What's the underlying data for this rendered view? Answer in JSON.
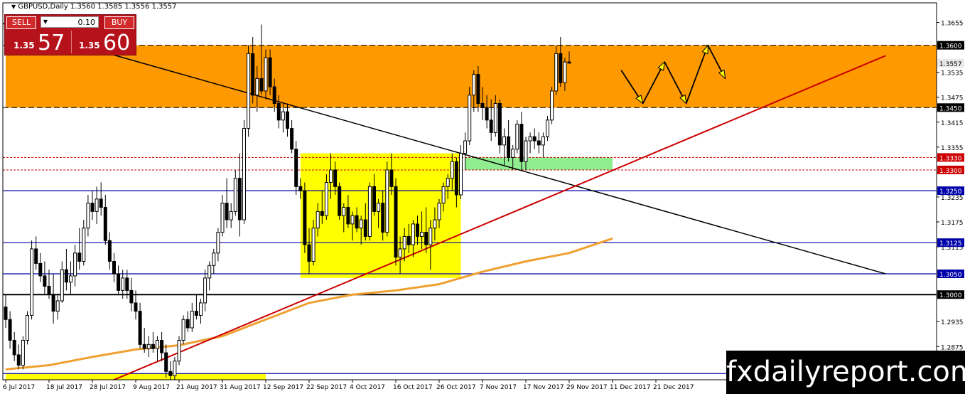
{
  "header": {
    "text": "GBPUSD,Daily  1.3560 1.3585 1.3556 1.3557",
    "icon": "triangle-down-icon"
  },
  "trade_panel": {
    "sell_label": "SELL",
    "buy_label": "BUY",
    "lot_value": "0.10",
    "sell_small": "1.35",
    "sell_big": "57",
    "buy_small": "1.35",
    "buy_big": "60"
  },
  "brand": {
    "text": "fxdailyreport.com"
  },
  "colors": {
    "resistance_zone": "#ff9900",
    "consolidation_zone": "#ffff00",
    "support_zone": "#90ee90",
    "moving_average": "#f0a030",
    "trendline_up": "#cc0000",
    "trendline_down": "#000000",
    "level_blue": "#0000aa"
  },
  "chart_data": {
    "type": "candlestick",
    "symbol": "GBPUSD",
    "timeframe": "Daily",
    "ylim": [
      1.2795,
      1.3685
    ],
    "y_ticks": [
      {
        "v": 1.3655,
        "label": "1.3655"
      },
      {
        "v": 1.3535,
        "label": "1.3535"
      },
      {
        "v": 1.3475,
        "label": "1.3475"
      },
      {
        "v": 1.3415,
        "label": "1.3415"
      },
      {
        "v": 1.3355,
        "label": "1.3355"
      },
      {
        "v": 1.3235,
        "label": "1.3235"
      },
      {
        "v": 1.3175,
        "label": "1.3175"
      },
      {
        "v": 1.3115,
        "label": "1.3115"
      },
      {
        "v": 1.2935,
        "label": "1.2935"
      },
      {
        "v": 1.2875,
        "label": "1.2875"
      }
    ],
    "price_labels": [
      {
        "v": 1.36,
        "label": "1.3600",
        "style": "dark"
      },
      {
        "v": 1.3557,
        "label": "1.3557",
        "style": "light"
      },
      {
        "v": 1.345,
        "label": "1.3450",
        "style": "dark"
      },
      {
        "v": 1.333,
        "label": "1.3330",
        "style": "red"
      },
      {
        "v": 1.33,
        "label": "1.3300",
        "style": "red"
      },
      {
        "v": 1.325,
        "label": "1.3250",
        "style": "blue"
      },
      {
        "v": 1.3125,
        "label": "1.3125",
        "style": "blue"
      },
      {
        "v": 1.305,
        "label": "1.3050",
        "style": "blue"
      },
      {
        "v": 1.3,
        "label": "1.3000",
        "style": "dark"
      }
    ],
    "x_labels": [
      "6 Jul 2017",
      "18 Jul 2017",
      "28 Jul 2017",
      "9 Aug 2017",
      "21 Aug 2017",
      "31 Aug 2017",
      "12 Sep 2017",
      "22 Sep 2017",
      "4 Oct 2017",
      "16 Oct 2017",
      "26 Oct 2017",
      "7 Nov 2017",
      "17 Nov 2017",
      "29 Nov 2017",
      "11 Dec 2017",
      "21 Dec 2017"
    ],
    "levels": [
      {
        "v": 1.36,
        "style": "dashed",
        "color": "#000000"
      },
      {
        "v": 1.345,
        "style": "dashed",
        "color": "#000000"
      },
      {
        "v": 1.333,
        "style": "dotted",
        "color": "#cc0000"
      },
      {
        "v": 1.33,
        "style": "dotted",
        "color": "#cc0000"
      },
      {
        "v": 1.325,
        "style": "solid",
        "color": "#0000aa"
      },
      {
        "v": 1.3125,
        "style": "solid",
        "color": "#0000aa"
      },
      {
        "v": 1.305,
        "style": "solid",
        "color": "#0000aa"
      },
      {
        "v": 1.3,
        "style": "solid",
        "color": "#000000"
      },
      {
        "v": 1.281,
        "style": "solid",
        "color": "#0000aa"
      }
    ],
    "zones": [
      {
        "name": "resistance",
        "bar_from": 0,
        "bar_to": 1000,
        "y_top": 1.36,
        "y_bot": 1.345,
        "color": "#ff9900"
      },
      {
        "name": "consolidation",
        "bar_from": 68,
        "bar_to": 105,
        "y_top": 1.334,
        "y_bot": 1.304,
        "color": "#ffff00"
      },
      {
        "name": "support",
        "bar_from": 106,
        "bar_to": 140,
        "y_top": 1.333,
        "y_bot": 1.33,
        "color": "#90ee90"
      },
      {
        "name": "lower",
        "bar_from": 0,
        "bar_to": 60,
        "y_top": 1.281,
        "y_bot": 1.2765,
        "color": "#ffff00"
      }
    ],
    "candles_ohlc": [
      [
        1.297,
        1.3,
        1.292,
        1.294
      ],
      [
        1.294,
        1.296,
        1.287,
        1.289
      ],
      [
        1.289,
        1.291,
        1.284,
        1.2855
      ],
      [
        1.2855,
        1.288,
        1.282,
        1.283
      ],
      [
        1.283,
        1.29,
        1.282,
        1.289
      ],
      [
        1.289,
        1.296,
        1.288,
        1.295
      ],
      [
        1.295,
        1.313,
        1.294,
        1.311
      ],
      [
        1.311,
        1.314,
        1.306,
        1.3075
      ],
      [
        1.3075,
        1.31,
        1.303,
        1.3045
      ],
      [
        1.3045,
        1.308,
        1.3,
        1.302
      ],
      [
        1.302,
        1.306,
        1.299,
        1.3
      ],
      [
        1.3,
        1.305,
        1.293,
        1.296
      ],
      [
        1.296,
        1.3,
        1.294,
        1.2985
      ],
      [
        1.2985,
        1.308,
        1.298,
        1.306
      ],
      [
        1.306,
        1.311,
        1.301,
        1.303
      ],
      [
        1.303,
        1.308,
        1.3,
        1.3045
      ],
      [
        1.3045,
        1.312,
        1.302,
        1.31
      ],
      [
        1.31,
        1.316,
        1.306,
        1.308
      ],
      [
        1.308,
        1.318,
        1.307,
        1.316
      ],
      [
        1.316,
        1.324,
        1.314,
        1.322
      ],
      [
        1.322,
        1.325,
        1.318,
        1.32
      ],
      [
        1.32,
        1.326,
        1.317,
        1.323
      ],
      [
        1.323,
        1.327,
        1.319,
        1.321
      ],
      [
        1.321,
        1.324,
        1.312,
        1.313
      ],
      [
        1.313,
        1.315,
        1.306,
        1.308
      ],
      [
        1.308,
        1.31,
        1.303,
        1.305
      ],
      [
        1.305,
        1.307,
        1.3,
        1.301
      ],
      [
        1.301,
        1.306,
        1.299,
        1.304
      ],
      [
        1.304,
        1.306,
        1.299,
        1.301
      ],
      [
        1.301,
        1.304,
        1.296,
        1.298
      ],
      [
        1.298,
        1.301,
        1.294,
        1.296
      ],
      [
        1.296,
        1.298,
        1.287,
        1.288
      ],
      [
        1.288,
        1.292,
        1.286,
        1.287
      ],
      [
        1.287,
        1.29,
        1.285,
        1.288
      ],
      [
        1.288,
        1.291,
        1.286,
        1.287
      ],
      [
        1.287,
        1.29,
        1.284,
        1.289
      ],
      [
        1.289,
        1.291,
        1.284,
        1.286
      ],
      [
        1.286,
        1.288,
        1.28,
        1.2815
      ],
      [
        1.2815,
        1.284,
        1.279,
        1.2805
      ],
      [
        1.2805,
        1.285,
        1.2795,
        1.284
      ],
      [
        1.284,
        1.29,
        1.283,
        1.289
      ],
      [
        1.289,
        1.295,
        1.288,
        1.294
      ],
      [
        1.294,
        1.296,
        1.291,
        1.292
      ],
      [
        1.292,
        1.298,
        1.291,
        1.296
      ],
      [
        1.296,
        1.3,
        1.294,
        1.295
      ],
      [
        1.295,
        1.299,
        1.293,
        1.298
      ],
      [
        1.298,
        1.306,
        1.296,
        1.304
      ],
      [
        1.304,
        1.308,
        1.301,
        1.307
      ],
      [
        1.307,
        1.311,
        1.305,
        1.31
      ],
      [
        1.31,
        1.316,
        1.308,
        1.315
      ],
      [
        1.315,
        1.324,
        1.314,
        1.322
      ],
      [
        1.322,
        1.328,
        1.316,
        1.318
      ],
      [
        1.318,
        1.322,
        1.316,
        1.32
      ],
      [
        1.32,
        1.33,
        1.319,
        1.328
      ],
      [
        1.328,
        1.334,
        1.314,
        1.318
      ],
      [
        1.318,
        1.342,
        1.317,
        1.34
      ],
      [
        1.34,
        1.36,
        1.338,
        1.358
      ],
      [
        1.358,
        1.362,
        1.346,
        1.348
      ],
      [
        1.348,
        1.355,
        1.344,
        1.352
      ],
      [
        1.352,
        1.365,
        1.348,
        1.349
      ],
      [
        1.349,
        1.359,
        1.347,
        1.357
      ],
      [
        1.357,
        1.359,
        1.348,
        1.35
      ],
      [
        1.35,
        1.352,
        1.344,
        1.346
      ],
      [
        1.346,
        1.348,
        1.34,
        1.342
      ],
      [
        1.342,
        1.346,
        1.339,
        1.344
      ],
      [
        1.344,
        1.346,
        1.338,
        1.34
      ],
      [
        1.34,
        1.342,
        1.334,
        1.335
      ],
      [
        1.335,
        1.337,
        1.324,
        1.326
      ],
      [
        1.326,
        1.328,
        1.323,
        1.325
      ],
      [
        1.325,
        1.327,
        1.31,
        1.312
      ],
      [
        1.312,
        1.316,
        1.305,
        1.308
      ],
      [
        1.308,
        1.318,
        1.307,
        1.316
      ],
      [
        1.316,
        1.322,
        1.314,
        1.32
      ],
      [
        1.32,
        1.325,
        1.317,
        1.319
      ],
      [
        1.319,
        1.329,
        1.318,
        1.327
      ],
      [
        1.327,
        1.334,
        1.323,
        1.33
      ],
      [
        1.33,
        1.332,
        1.324,
        1.326
      ],
      [
        1.326,
        1.327,
        1.318,
        1.319
      ],
      [
        1.319,
        1.322,
        1.315,
        1.321
      ],
      [
        1.321,
        1.324,
        1.316,
        1.317
      ],
      [
        1.317,
        1.32,
        1.313,
        1.319
      ],
      [
        1.319,
        1.321,
        1.315,
        1.316
      ],
      [
        1.316,
        1.319,
        1.312,
        1.318
      ],
      [
        1.318,
        1.322,
        1.313,
        1.314
      ],
      [
        1.314,
        1.327,
        1.313,
        1.326
      ],
      [
        1.326,
        1.329,
        1.319,
        1.32
      ],
      [
        1.32,
        1.323,
        1.316,
        1.322
      ],
      [
        1.322,
        1.325,
        1.313,
        1.315
      ],
      [
        1.315,
        1.332,
        1.314,
        1.33
      ],
      [
        1.33,
        1.334,
        1.324,
        1.326
      ],
      [
        1.326,
        1.328,
        1.307,
        1.309
      ],
      [
        1.309,
        1.314,
        1.305,
        1.311
      ],
      [
        1.311,
        1.316,
        1.308,
        1.314
      ],
      [
        1.314,
        1.317,
        1.31,
        1.312
      ],
      [
        1.312,
        1.318,
        1.309,
        1.317
      ],
      [
        1.317,
        1.319,
        1.312,
        1.314
      ],
      [
        1.314,
        1.32,
        1.311,
        1.315
      ],
      [
        1.315,
        1.321,
        1.31,
        1.312
      ],
      [
        1.312,
        1.318,
        1.306,
        1.316
      ],
      [
        1.316,
        1.321,
        1.313,
        1.318
      ],
      [
        1.318,
        1.323,
        1.316,
        1.322
      ],
      [
        1.322,
        1.327,
        1.32,
        1.326
      ],
      [
        1.326,
        1.329,
        1.323,
        1.328
      ],
      [
        1.328,
        1.334,
        1.325,
        1.332
      ],
      [
        1.332,
        1.333,
        1.321,
        1.324
      ],
      [
        1.324,
        1.336,
        1.323,
        1.334
      ],
      [
        1.334,
        1.339,
        1.33,
        1.337
      ],
      [
        1.337,
        1.35,
        1.336,
        1.348
      ],
      [
        1.348,
        1.354,
        1.344,
        1.353
      ],
      [
        1.353,
        1.355,
        1.344,
        1.346
      ],
      [
        1.346,
        1.35,
        1.342,
        1.345
      ],
      [
        1.345,
        1.348,
        1.34,
        1.342
      ],
      [
        1.342,
        1.347,
        1.337,
        1.339
      ],
      [
        1.339,
        1.348,
        1.338,
        1.346
      ],
      [
        1.346,
        1.347,
        1.334,
        1.336
      ],
      [
        1.336,
        1.34,
        1.331,
        1.338
      ],
      [
        1.338,
        1.342,
        1.332,
        1.333
      ],
      [
        1.333,
        1.336,
        1.33,
        1.335
      ],
      [
        1.335,
        1.342,
        1.334,
        1.341
      ],
      [
        1.341,
        1.344,
        1.33,
        1.332
      ],
      [
        1.332,
        1.338,
        1.33,
        1.337
      ],
      [
        1.337,
        1.339,
        1.334,
        1.338
      ],
      [
        1.338,
        1.34,
        1.335,
        1.337
      ],
      [
        1.337,
        1.339,
        1.334,
        1.336
      ],
      [
        1.336,
        1.339,
        1.333,
        1.338
      ],
      [
        1.338,
        1.343,
        1.337,
        1.342
      ],
      [
        1.342,
        1.35,
        1.341,
        1.349
      ],
      [
        1.349,
        1.36,
        1.348,
        1.358
      ],
      [
        1.358,
        1.362,
        1.35,
        1.351
      ],
      [
        1.351,
        1.357,
        1.349,
        1.356
      ],
      [
        1.356,
        1.3585,
        1.3556,
        1.3557
      ]
    ],
    "moving_average": [
      [
        0,
        1.282
      ],
      [
        10,
        1.283
      ],
      [
        20,
        1.285
      ],
      [
        30,
        1.2868
      ],
      [
        40,
        1.2878
      ],
      [
        50,
        1.29
      ],
      [
        60,
        1.294
      ],
      [
        70,
        1.298
      ],
      [
        80,
        1.3
      ],
      [
        90,
        1.301
      ],
      [
        100,
        1.3025
      ],
      [
        110,
        1.3055
      ],
      [
        120,
        1.308
      ],
      [
        130,
        1.31
      ],
      [
        140,
        1.3135
      ]
    ],
    "trendline_down": [
      [
        -10,
        1.368
      ],
      [
        203,
        1.305
      ]
    ],
    "trendline_up": [
      [
        17,
        1.276
      ],
      [
        203,
        1.3575
      ]
    ],
    "projection": [
      [
        142,
        1.354
      ],
      [
        147,
        1.346
      ],
      [
        152,
        1.356
      ],
      [
        157,
        1.346
      ],
      [
        162,
        1.36
      ],
      [
        166,
        1.352
      ]
    ]
  }
}
